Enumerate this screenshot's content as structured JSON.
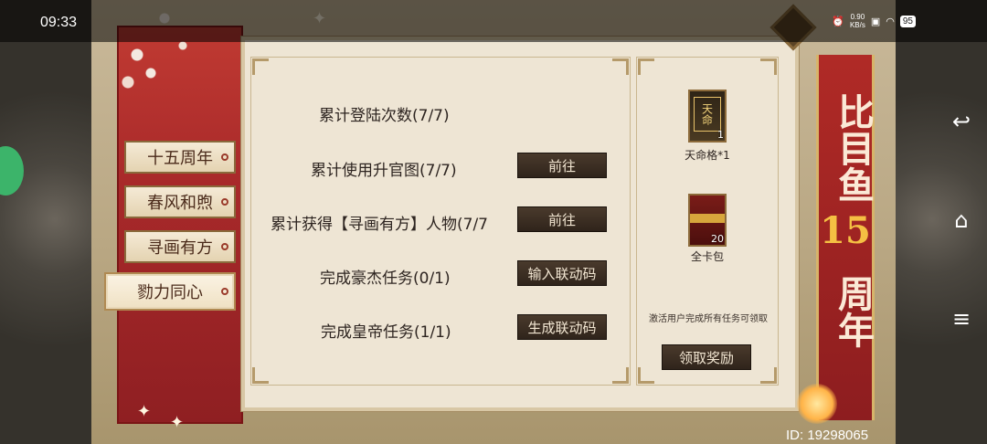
{
  "status_bar": {
    "time": "09:33",
    "net_speed_value": "0.90",
    "net_speed_unit": "KB/s",
    "battery": "95"
  },
  "tabs": [
    {
      "label": "十五周年",
      "active": false
    },
    {
      "label": "春风和煦",
      "active": false
    },
    {
      "label": "寻画有方",
      "active": false
    },
    {
      "label": "勠力同心",
      "active": true
    }
  ],
  "tasks": [
    {
      "label": "累计登陆次数(7/7)",
      "button": ""
    },
    {
      "label": "累计使用升官图(7/7)",
      "button": "前往"
    },
    {
      "label": "累计获得【寻画有方】人物(7/7",
      "button": "前往"
    },
    {
      "label": "完成豪杰任务(0/1)",
      "button": "输入联动码"
    },
    {
      "label": "完成皇帝任务(1/1)",
      "button": "生成联动码"
    }
  ],
  "rewards": [
    {
      "name": "天命格*1",
      "count": "1",
      "card_text": "天命"
    },
    {
      "name": "全卡包",
      "count": "20"
    }
  ],
  "reward_hint": "激活用户完成所有任务可领取",
  "claim_button": "领取奖励",
  "banner_text_top": "比目鱼",
  "banner_number": "15",
  "banner_text_bottom": "周年",
  "player_id": "ID: 19298065",
  "colors": {
    "panel_bg": "#eee5d4",
    "red_banner": "#a8292a",
    "button_dark": "#2f241b",
    "gold": "#f5c043"
  }
}
